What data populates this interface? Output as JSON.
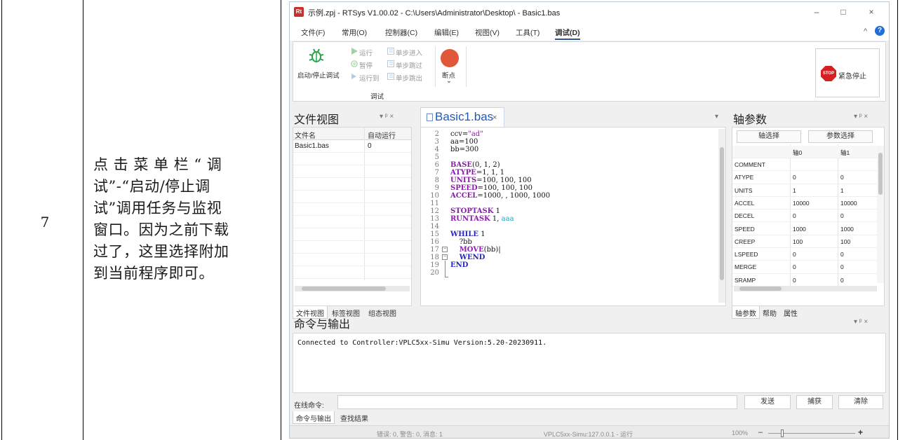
{
  "doc": {
    "step_number": "7",
    "description_lines": [
      "点 击 菜 单 栏 “ 调",
      "试”-“启动/停止调",
      "试”调用任务与监视",
      "窗口。因为之前下载",
      "过了，这里选择附加",
      "到当前程序即可。"
    ]
  },
  "window": {
    "title": "示例.zpj - RTSys V1.00.02 - C:\\Users\\Administrator\\Desktop\\ - Basic1.bas",
    "app_icon": "Rt",
    "controls": [
      "–",
      "□",
      "×"
    ]
  },
  "menu": {
    "items": [
      "文件(F)",
      "常用(O)",
      "控制器(C)",
      "编辑(E)",
      "视图(V)",
      "工具(T)",
      "调试(D)"
    ],
    "active_index": 6,
    "collapse_glyph": "^",
    "help_glyph": "?"
  },
  "ribbon": {
    "start_stop_debug": "启动/停止调试",
    "run": "运行",
    "pause": "暂停",
    "run_to": "运行到",
    "step_into": "单步进入",
    "step_over": "单步跳过",
    "step_out": "单步跳出",
    "breakpoint": "断点",
    "breakpoint_arrow": "⌄",
    "group_label": "调试",
    "stop_sign": "STOP",
    "emergency_stop": "紧急停止"
  },
  "file_view": {
    "title": "文件视图",
    "pin_controls": "▾ ᵖ ×",
    "col_name": "文件名",
    "col_autorun": "自动运行",
    "rows": [
      {
        "name": "Basic1.bas",
        "autorun": "0"
      }
    ],
    "tabs": [
      "文件视图",
      "标签视图",
      "组态视图"
    ]
  },
  "editor": {
    "tab_name": "Basic1.bas",
    "tab_close": "×",
    "dropdown": "▾",
    "lines": [
      {
        "n": "2",
        "html": "ccv=<span class='str'>\"ad\"</span>"
      },
      {
        "n": "3",
        "html": "aa=100"
      },
      {
        "n": "4",
        "html": "bb=300"
      },
      {
        "n": "5",
        "html": ""
      },
      {
        "n": "6",
        "html": "<span class='kw'>BASE</span>(0, 1, 2)"
      },
      {
        "n": "7",
        "html": "<span class='kw'>ATYPE</span>=1, 1, 1"
      },
      {
        "n": "8",
        "html": "<span class='kw'>UNITS</span>=100, 100, 100"
      },
      {
        "n": "9",
        "html": "<span class='kw'>SPEED</span>=100, 100, 100"
      },
      {
        "n": "10",
        "html": "<span class='kw'>ACCEL</span>=1000, , 1000, 1000"
      },
      {
        "n": "11",
        "html": ""
      },
      {
        "n": "12",
        "html": "<span class='kw'>STOPTASK</span> 1"
      },
      {
        "n": "13",
        "html": "<span class='kw'>RUNTASK</span> 1, <span style='color:#1aa3c7'>aaa</span>"
      },
      {
        "n": "14",
        "html": ""
      },
      {
        "n": "15",
        "html": "<span class='kw2'>WHILE</span> 1"
      },
      {
        "n": "16",
        "html": "&nbsp;&nbsp;&nbsp;&nbsp;?bb"
      },
      {
        "n": "17",
        "html": "&nbsp;&nbsp;&nbsp;&nbsp;<span class='kw'>MOVE</span>(bb)|"
      },
      {
        "n": "18",
        "html": "&nbsp;&nbsp;&nbsp;&nbsp;<span class='kw2'>WEND</span>"
      },
      {
        "n": "19",
        "html": "<span class='kw2'>END</span>"
      },
      {
        "n": "20",
        "html": ""
      }
    ]
  },
  "axis_params": {
    "title": "轴参数",
    "pin_controls": "▾ ᵖ ×",
    "btn_axis_select": "轴选择",
    "btn_param_select": "参数选择",
    "col_axis0": "轴0",
    "col_axis1": "轴1",
    "rows": [
      {
        "name": "COMMENT",
        "a0": "",
        "a1": ""
      },
      {
        "name": "ATYPE",
        "a0": "0",
        "a1": "0"
      },
      {
        "name": "UNITS",
        "a0": "1",
        "a1": "1"
      },
      {
        "name": "ACCEL",
        "a0": "10000",
        "a1": "10000"
      },
      {
        "name": "DECEL",
        "a0": "0",
        "a1": "0"
      },
      {
        "name": "SPEED",
        "a0": "1000",
        "a1": "1000"
      },
      {
        "name": "CREEP",
        "a0": "100",
        "a1": "100"
      },
      {
        "name": "LSPEED",
        "a0": "0",
        "a1": "0"
      },
      {
        "name": "MERGE",
        "a0": "0",
        "a1": "0"
      },
      {
        "name": "SRAMP",
        "a0": "0",
        "a1": "0"
      }
    ],
    "tabs": [
      "轴参数",
      "帮助",
      "属性"
    ]
  },
  "console": {
    "title": "命令与输出",
    "pin_controls": "▾ ᵖ ×",
    "output": "Connected to Controller:VPLC5xx-Simu Version:5.20-20230911.",
    "cmd_label": "在线命令:",
    "cmd_value": "",
    "send": "发送",
    "capture": "捕获",
    "clear": "清除",
    "tabs": [
      "命令与输出",
      "查找结果"
    ]
  },
  "status": {
    "messages": "错误: 0, 警告: 0, 消息: 1",
    "connection": "VPLC5xx-Simu:127.0.0.1 - 运行",
    "zoom": "100%",
    "zoom_minus": "–",
    "zoom_plus": "+"
  }
}
